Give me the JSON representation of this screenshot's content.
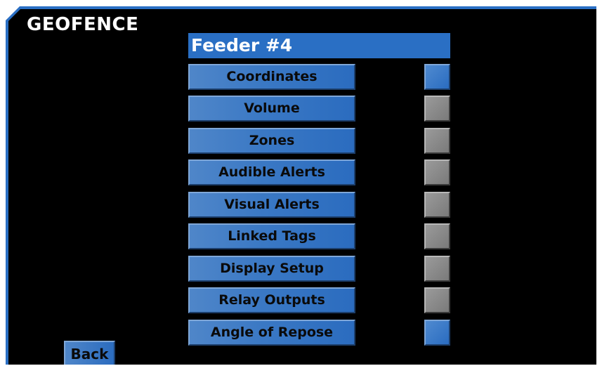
{
  "screen": {
    "title": "GEOFENCE",
    "device_name": "Feeder #4"
  },
  "menu": {
    "items": [
      {
        "label": "Coordinates",
        "status": "on"
      },
      {
        "label": "Volume",
        "status": "off"
      },
      {
        "label": "Zones",
        "status": "off"
      },
      {
        "label": "Audible Alerts",
        "status": "off"
      },
      {
        "label": "Visual Alerts",
        "status": "off"
      },
      {
        "label": "Linked Tags",
        "status": "off"
      },
      {
        "label": "Display Setup",
        "status": "off"
      },
      {
        "label": "Relay Outputs",
        "status": "off"
      },
      {
        "label": "Angle of Repose",
        "status": "on"
      }
    ]
  },
  "footer": {
    "back_label": "Back"
  },
  "colors": {
    "accent": "#2a6fc4",
    "background": "#000000",
    "indicator_on": "#2a6cc0",
    "indicator_off": "#8a8a8a"
  }
}
